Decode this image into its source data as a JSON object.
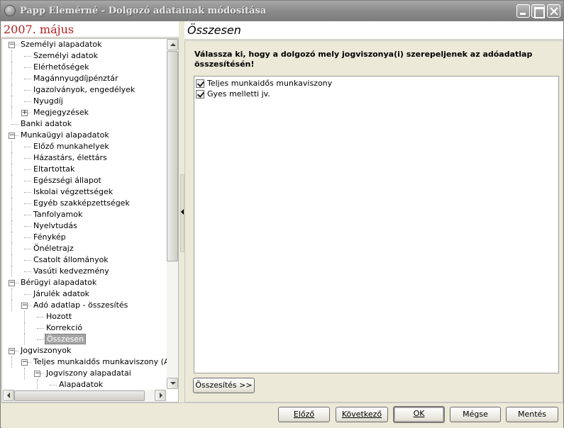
{
  "window": {
    "title": "Papp Elemérné - Dolgozó adatainak módosítása"
  },
  "left_header": {
    "period": "2007. május"
  },
  "tree": {
    "items": [
      {
        "label": "Személyi alapadatok",
        "level": 0,
        "expander": "minus"
      },
      {
        "label": "Személyi adatok",
        "level": 1
      },
      {
        "label": "Elérhetőségek",
        "level": 1
      },
      {
        "label": "Magánnyugdíjpénztár",
        "level": 1
      },
      {
        "label": "Igazolványok, engedélyek",
        "level": 1
      },
      {
        "label": "Nyugdíj",
        "level": 1
      },
      {
        "label": "Megjegyzések",
        "level": 1,
        "expander": "plus"
      },
      {
        "label": "Banki adatok",
        "level": 0
      },
      {
        "label": "Munkaügyi alapadatok",
        "level": 0,
        "expander": "minus"
      },
      {
        "label": "Előző munkahelyek",
        "level": 1
      },
      {
        "label": "Házastárs, élettárs",
        "level": 1
      },
      {
        "label": "Eltartottak",
        "level": 1
      },
      {
        "label": "Egészségi állapot",
        "level": 1
      },
      {
        "label": "Iskolai végzettségek",
        "level": 1
      },
      {
        "label": "Egyéb szakképzettségek",
        "level": 1
      },
      {
        "label": "Tanfolyamok",
        "level": 1
      },
      {
        "label": "Nyelvtudás",
        "level": 1
      },
      {
        "label": "Fénykép",
        "level": 1
      },
      {
        "label": "Önéletrajz",
        "level": 1
      },
      {
        "label": "Csatolt állományok",
        "level": 1
      },
      {
        "label": "Vasúti kedvezmény",
        "level": 1
      },
      {
        "label": "Bérügyi alapadatok",
        "level": 0,
        "expander": "minus"
      },
      {
        "label": "Járulék adatok",
        "level": 1
      },
      {
        "label": "Adó adatlap - összesítés",
        "level": 1,
        "expander": "minus"
      },
      {
        "label": "Hozott",
        "level": 2
      },
      {
        "label": "Korrekció",
        "level": 2
      },
      {
        "label": "Összesen",
        "level": 2,
        "selected": true
      },
      {
        "label": "Jogviszonyok",
        "level": 0,
        "expander": "minus"
      },
      {
        "label": "Teljes munkaidős munkaviszony (Alapér",
        "level": 1,
        "expander": "minus"
      },
      {
        "label": "Jogviszony alapadatai",
        "level": 2,
        "expander": "minus"
      },
      {
        "label": "Alapadatok",
        "level": 3
      }
    ]
  },
  "right": {
    "header": "Összesen",
    "instruction": "Válassza ki, hogy a dolgozó mely jogviszonya(i) szerepeljenek az adóadatlap összesítésén!",
    "checkboxes": [
      {
        "label": "Teljes munkaidős munkaviszony",
        "checked": true
      },
      {
        "label": "Gyes melletti jv.",
        "checked": true
      }
    ],
    "summary_button": "Összesítés >>"
  },
  "footer": {
    "prev": "Előző",
    "next": "Következő",
    "ok": "OK",
    "cancel": "Mégse",
    "save": "Mentés"
  }
}
